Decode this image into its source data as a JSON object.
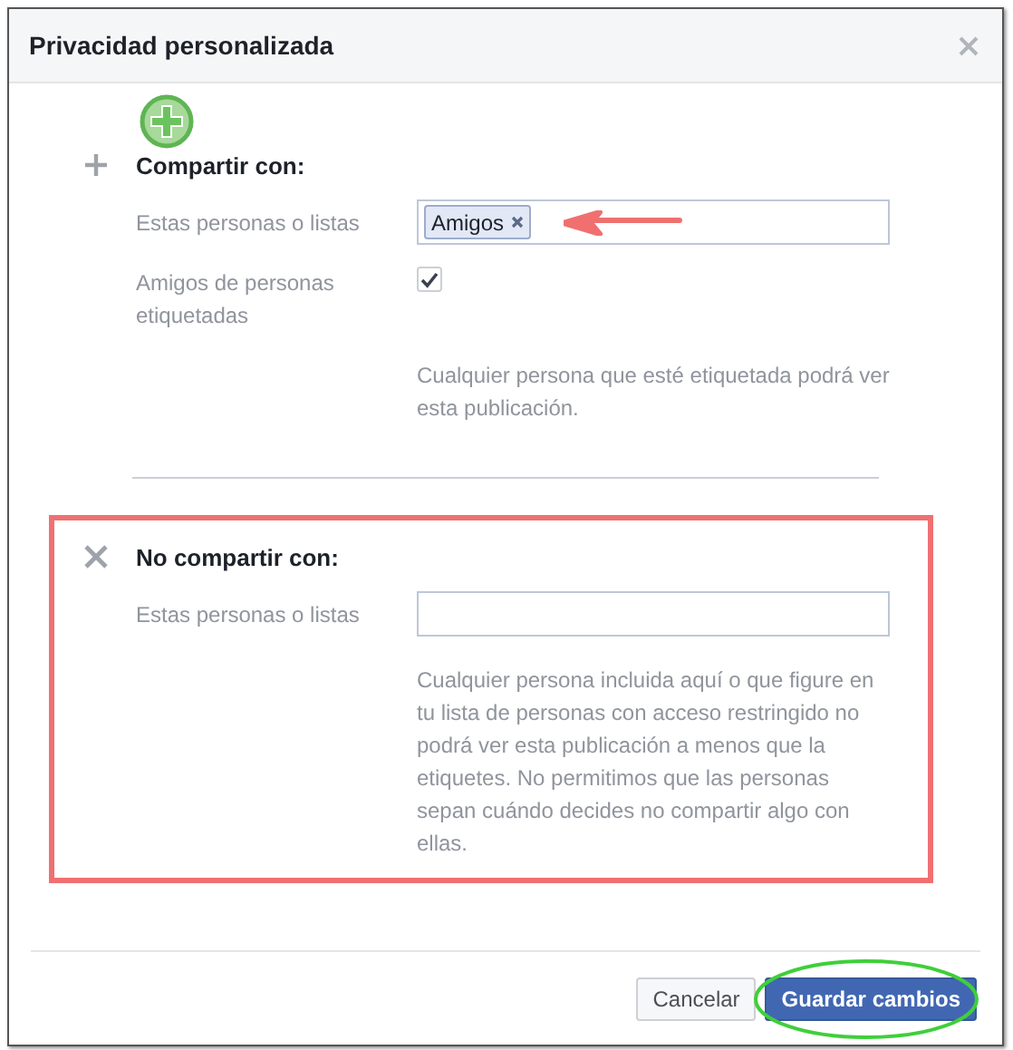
{
  "dialog": {
    "title": "Privacidad personalizada"
  },
  "share_with": {
    "heading": "Compartir con:",
    "highlighted": false,
    "field_label": "Estas personas o listas",
    "tokens": [
      "Amigos"
    ],
    "checkbox_label": "Amigos de personas etiquetadas",
    "checked": true,
    "help": "Cualquier persona que esté etiquetada podrá ver esta publicación."
  },
  "dont_share_with": {
    "heading": "No compartir con:",
    "highlighted": true,
    "field_label": "Estas personas o listas",
    "help": "Cualquier persona incluida aquí o que figure en tu lista de personas con acceso restringido no podrá ver esta publicación a menos que la etiquetes. No permitimos que las personas sepan cuándo decides no compartir algo con ellas."
  },
  "buttons": [
    {
      "label": "Cancelar",
      "kind": "secondary"
    },
    {
      "label": "Guardar cambios",
      "kind": "primary"
    }
  ]
}
